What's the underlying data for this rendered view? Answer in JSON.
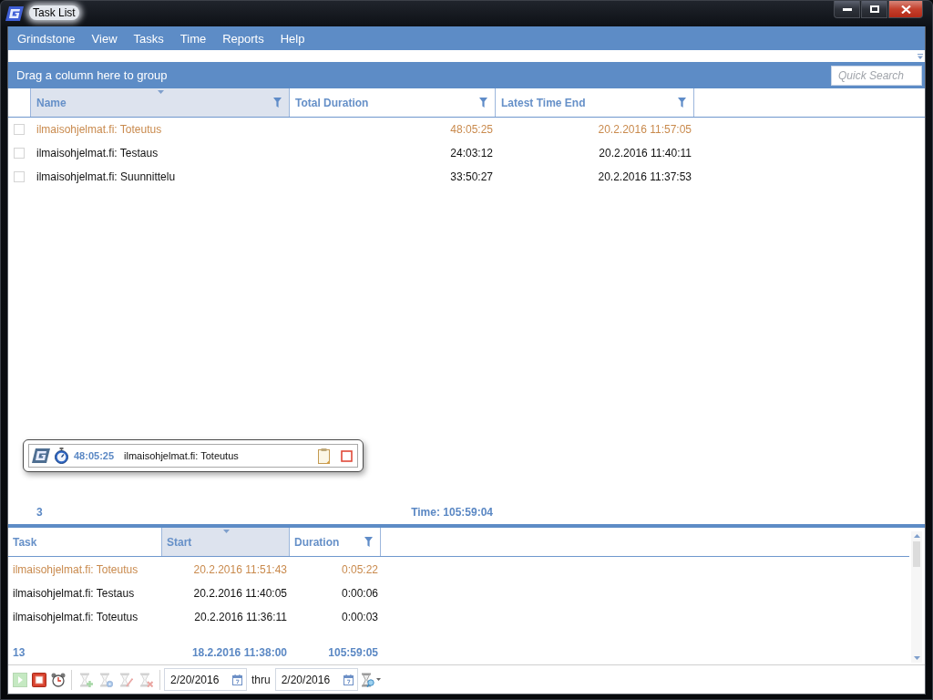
{
  "window": {
    "title": "Task List"
  },
  "menu": [
    "Grindstone",
    "View",
    "Tasks",
    "Time",
    "Reports",
    "Help"
  ],
  "group_panel": {
    "hint": "Drag a column here to group",
    "search_placeholder": "Quick Search"
  },
  "task_grid": {
    "columns": [
      {
        "label": "Name",
        "sorted": true,
        "filter": true
      },
      {
        "label": "Total Duration",
        "sorted": false,
        "filter": true
      },
      {
        "label": "Latest Time End",
        "sorted": false,
        "filter": true
      }
    ],
    "rows": [
      {
        "checked": false,
        "running": true,
        "cells": [
          "ilmaisohjelmat.fi: Toteutus",
          "48:05:25",
          "20.2.2016 11:57:05"
        ]
      },
      {
        "checked": false,
        "running": false,
        "cells": [
          "ilmaisohjelmat.fi: Testaus",
          "24:03:12",
          "20.2.2016 11:40:11"
        ]
      },
      {
        "checked": false,
        "running": false,
        "cells": [
          "ilmaisohjelmat.fi: Suunnittelu",
          "33:50:27",
          "20.2.2016 11:37:53"
        ]
      }
    ],
    "summary": [
      "3",
      "Time: 105:59:04"
    ]
  },
  "timer_widget": {
    "elapsed": "48:05:25",
    "task": "ilmaisohjelmat.fi: Toteutus"
  },
  "time_grid": {
    "columns": [
      {
        "label": "Task",
        "sorted": false,
        "filter": false
      },
      {
        "label": "Start",
        "sorted": true,
        "filter": false
      },
      {
        "label": "Duration",
        "sorted": false,
        "filter": true
      }
    ],
    "rows": [
      {
        "running": true,
        "cells": [
          "ilmaisohjelmat.fi: Toteutus",
          "20.2.2016 11:51:43",
          "0:05:22"
        ]
      },
      {
        "running": false,
        "cells": [
          "ilmaisohjelmat.fi: Testaus",
          "20.2.2016 11:40:05",
          "0:00:06"
        ]
      },
      {
        "running": false,
        "cells": [
          "ilmaisohjelmat.fi: Toteutus",
          "20.2.2016 11:36:11",
          "0:00:03"
        ]
      }
    ],
    "summary": [
      "13",
      "18.2.2016 11:38:00",
      "105:59:05"
    ]
  },
  "toolbar": {
    "groups": [
      [
        {
          "kind": "start",
          "disabled": true
        },
        {
          "kind": "stop",
          "disabled": false
        },
        {
          "kind": "alarm",
          "disabled": false
        }
      ],
      [
        {
          "kind": "add",
          "disabled": true
        },
        {
          "kind": "settings",
          "disabled": true
        },
        {
          "kind": "edit",
          "disabled": true
        },
        {
          "kind": "delete",
          "disabled": true
        }
      ]
    ],
    "from_date": "2/20/2016",
    "range_label": "thru",
    "to_date": "2/20/2016"
  }
}
